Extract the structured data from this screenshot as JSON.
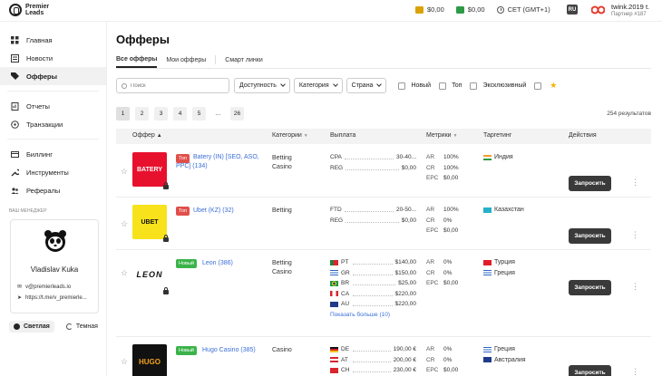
{
  "header": {
    "logo_line1": "Premier",
    "logo_line2": "Leads",
    "balances": [
      {
        "value": "$0,00",
        "color": "#d9a200"
      },
      {
        "value": "$0,00",
        "color": "#2e9a45"
      }
    ],
    "timezone": "CET (GMT+1)",
    "lang": "RU",
    "user_name": "twink.2019 t.",
    "user_sub": "Партнер #187"
  },
  "sidebar": {
    "items": [
      {
        "label": "Главная",
        "icon": "grid-icon"
      },
      {
        "label": "Новости",
        "icon": "news-icon"
      },
      {
        "label": "Офферы",
        "icon": "tag-icon"
      },
      {
        "label": "Отчеты",
        "icon": "report-icon"
      },
      {
        "label": "Транзакции",
        "icon": "transactions-icon"
      },
      {
        "label": "Биллинг",
        "icon": "billing-icon"
      },
      {
        "label": "Инструменты",
        "icon": "tools-icon"
      },
      {
        "label": "Рефералы",
        "icon": "referrals-icon"
      }
    ],
    "manager_title": "ВАШ МЕНЕДЖЕР",
    "manager_name": "Vladislav Kuka",
    "manager_email": "v@premierleads.io",
    "manager_tg": "https://t.me/v_premierle...",
    "theme_light": "Светлая",
    "theme_dark": "Темная"
  },
  "page": {
    "title": "Офферы",
    "tabs": [
      "Все офферы",
      "Мои офферы",
      "Смарт линки"
    ],
    "search_placeholder": "Поиск",
    "filters": [
      "Доступность",
      "Категория",
      "Страна"
    ],
    "checkboxes": [
      "Новый",
      "Топ",
      "Эксклюзивный"
    ],
    "pages": [
      "1",
      "2",
      "3",
      "4",
      "5",
      "...",
      "26"
    ],
    "results": "254 результатов",
    "columns": [
      "Оффер",
      "Категории",
      "Выплата",
      "Метрики",
      "Таргетинг",
      "Действия"
    ]
  },
  "offers": [
    {
      "badge": "Топ",
      "name": "Batery (IN) [SEO, ASO, PPC] (134)",
      "thumb_text": "BATERY",
      "categories": [
        "Betting",
        "Casino"
      ],
      "payouts": [
        {
          "k": "CPA",
          "v": "30-40..."
        },
        {
          "k": "REG",
          "v": "$0,00"
        }
      ],
      "metrics": [
        {
          "k": "AR",
          "v": "100%"
        },
        {
          "k": "CR",
          "v": "100%"
        },
        {
          "k": "EPC",
          "v": "$0,00"
        }
      ],
      "targeting": [
        "Индия"
      ],
      "action": "Запросить"
    },
    {
      "badge": "Топ",
      "name": "Ubet (KZ) (32)",
      "thumb_text": "UBET",
      "categories": [
        "Betting"
      ],
      "payouts": [
        {
          "k": "FTD",
          "v": "20-50..."
        },
        {
          "k": "REG",
          "v": "$0,00"
        }
      ],
      "metrics": [
        {
          "k": "AR",
          "v": "100%"
        },
        {
          "k": "CR",
          "v": "0%"
        },
        {
          "k": "EPC",
          "v": "$0,00"
        }
      ],
      "targeting": [
        "Казахстан"
      ],
      "action": "Запросить"
    },
    {
      "badge": "Новый",
      "name": "Leon (386)",
      "thumb_text": "LEON",
      "categories": [
        "Betting",
        "Casino"
      ],
      "payouts": [
        {
          "k": "PT",
          "v": "$140,00"
        },
        {
          "k": "GR",
          "v": "$150,00"
        },
        {
          "k": "BR",
          "v": "$25,00"
        },
        {
          "k": "CA",
          "v": "$220,00"
        },
        {
          "k": "AU",
          "v": "$220,00"
        }
      ],
      "more": "Показать больше (10)",
      "metrics": [
        {
          "k": "AR",
          "v": "0%"
        },
        {
          "k": "CR",
          "v": "0%"
        },
        {
          "k": "EPC",
          "v": "$0,00"
        }
      ],
      "targeting": [
        "Турция",
        "Греция"
      ],
      "action": "Запросить"
    },
    {
      "badge": "Новый",
      "name": "Hugo Casino (385)",
      "thumb_text": "HUGO",
      "categories": [
        "Casino"
      ],
      "payouts": [
        {
          "k": "DE",
          "v": "190,00 €"
        },
        {
          "k": "AT",
          "v": "200,00 €"
        },
        {
          "k": "CH",
          "v": "230,00 €"
        }
      ],
      "metrics": [
        {
          "k": "AR",
          "v": "0%"
        },
        {
          "k": "CR",
          "v": "0%"
        },
        {
          "k": "EPC",
          "v": "$0,00"
        }
      ],
      "targeting": [
        "Греция",
        "Австралия"
      ],
      "action": "Запросить"
    }
  ]
}
